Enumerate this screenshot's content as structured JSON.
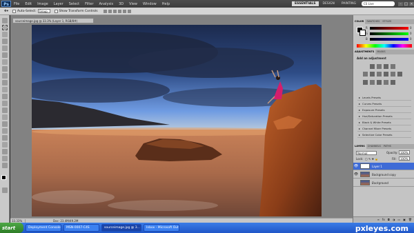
{
  "app": {
    "logo": "Ps",
    "menus": [
      "File",
      "Edit",
      "Image",
      "Layer",
      "Select",
      "Filter",
      "Analysis",
      "3D",
      "View",
      "Window",
      "Help"
    ],
    "workspaces": [
      "ESSENTIALS",
      "DESIGN",
      "PAINTING"
    ],
    "active_workspace": "ESSENTIALS",
    "cs_live": "CS Live"
  },
  "options": {
    "auto_select_label": "Auto-Select:",
    "auto_select_value": "Group",
    "transform_label": "Show Transform Controls"
  },
  "document": {
    "tab_title": "sourceimage.jpg @ 33.3% (Layer 1, RGB/8#)",
    "zoom": "33.33%",
    "doc_info": "Doc: 23.4M/49.2M"
  },
  "panels": {
    "color_tabs": [
      "COLOR",
      "SWATCHES",
      "STYLES"
    ],
    "color_sliders": [
      {
        "letter": "R",
        "value": "0"
      },
      {
        "letter": "G",
        "value": "0"
      },
      {
        "letter": "B",
        "value": "0"
      }
    ],
    "adjust_tabs": [
      "ADJUSTMENTS",
      "MASKS"
    ],
    "adjust_title": "Add an adjustment",
    "adjust_presets": [
      "Levels Presets",
      "Curves Presets",
      "Exposure Presets",
      "Hue/Saturation Presets",
      "Black & White Presets",
      "Channel Mixer Presets",
      "Selective Color Presets"
    ],
    "layers_tabs": [
      "LAYERS",
      "CHANNELS",
      "PATHS"
    ],
    "blend_mode": "Normal",
    "opacity_label": "Opacity:",
    "opacity_value": "100%",
    "lock_label": "Lock:",
    "fill_label": "Fill:",
    "fill_value": "100%",
    "layers": [
      {
        "name": "Layer 1",
        "selected": true
      },
      {
        "name": "Background copy",
        "selected": false
      },
      {
        "name": "Background",
        "selected": false
      }
    ]
  },
  "taskbar": {
    "start": "start",
    "tasks": [
      {
        "label": "Deployment Console",
        "active": false
      },
      {
        "label": "MSN-0007-C4S",
        "active": false
      },
      {
        "label": "sourceimage.jpg @ 3...",
        "active": true
      },
      {
        "label": "Inbox - Microsoft Out...",
        "active": false
      }
    ],
    "watermark": "pxleyes.com"
  }
}
